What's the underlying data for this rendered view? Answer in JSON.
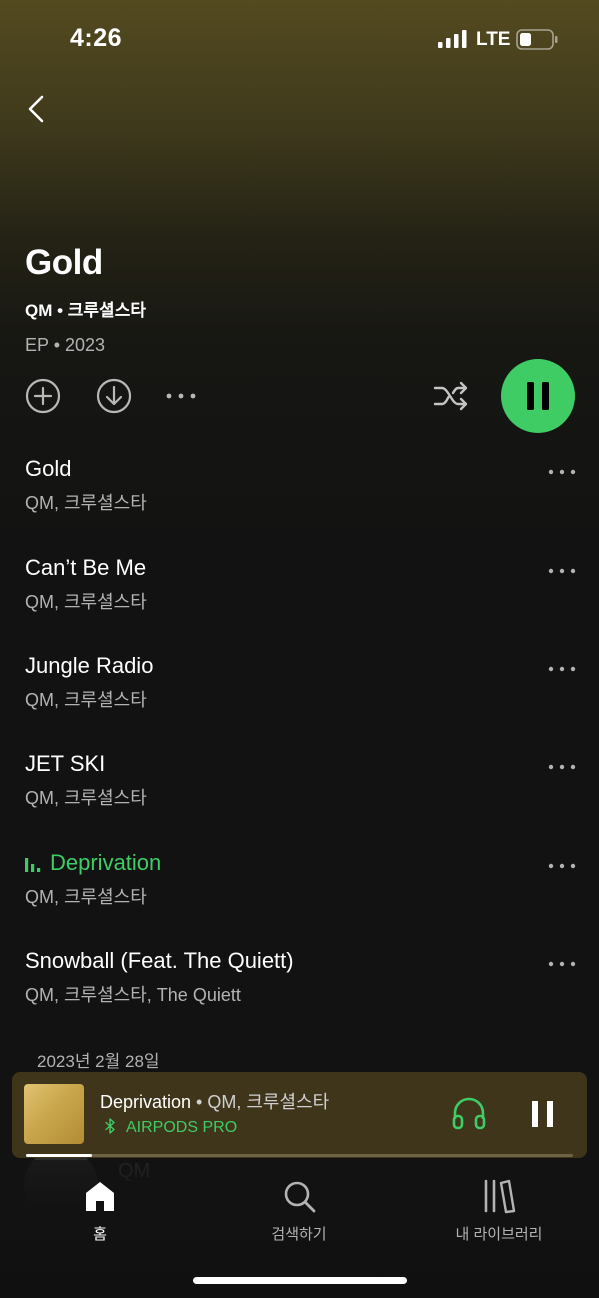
{
  "status_bar": {
    "time": "4:26",
    "network": "LTE",
    "icons": [
      "signal-icon",
      "battery-icon"
    ]
  },
  "album": {
    "title": "Gold",
    "artists": "QM • 크루셜스타",
    "meta": "EP • 2023",
    "release_date": "2023년 2월 28일"
  },
  "actions": {
    "icons": [
      "add-icon",
      "download-icon",
      "more-icon",
      "shuffle-icon",
      "pause-icon"
    ]
  },
  "tracks": [
    {
      "title": "Gold",
      "artist": "QM, 크루셜스타",
      "playing": false
    },
    {
      "title": "Can’t Be Me",
      "artist": "QM, 크루셜스타",
      "playing": false
    },
    {
      "title": "Jungle Radio",
      "artist": "QM, 크루셜스타",
      "playing": false
    },
    {
      "title": "JET SKI",
      "artist": "QM, 크루셜스타",
      "playing": false
    },
    {
      "title": "Deprivation",
      "artist": "QM, 크루셜스타",
      "playing": true
    },
    {
      "title": "Snowball (Feat. The Quiett)",
      "artist": "QM, 크루셜스타, The Quiett",
      "playing": false
    }
  ],
  "ghost_artist": {
    "name": "QM"
  },
  "now_playing": {
    "title": "Deprivation",
    "separator": " • ",
    "artist": "QM, 크루셜스타",
    "device": "AIRPODS PRO",
    "progress": 0.12
  },
  "nav": [
    {
      "label": "홈",
      "icon": "home-icon",
      "active": true
    },
    {
      "label": "검색하기",
      "icon": "search-icon",
      "active": false
    },
    {
      "label": "내 라이브러리",
      "icon": "library-icon",
      "active": false
    }
  ],
  "colors": {
    "accent": "#3fcc65",
    "background": "#121212",
    "header_tint": "#544a20",
    "mini_player": "#3e351b",
    "secondary_text": "#b3b3b3"
  }
}
